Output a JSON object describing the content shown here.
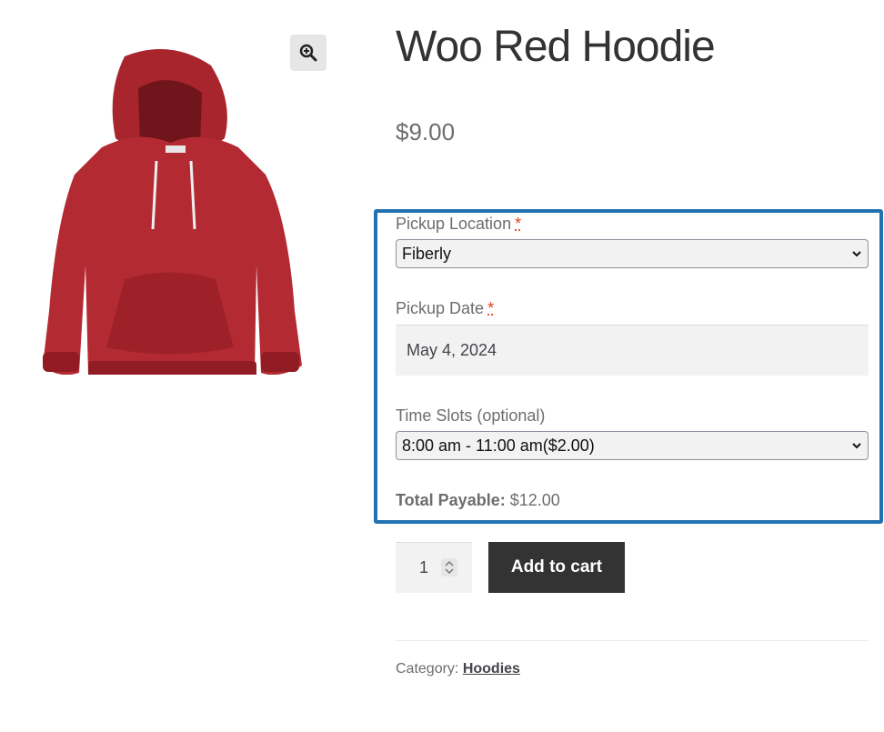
{
  "product": {
    "title": "Woo Red Hoodie",
    "price": "$9.00"
  },
  "gallery": {
    "zoom_icon": "magnifier-plus-icon",
    "image_alt": "Red hoodie"
  },
  "options": {
    "pickup_location": {
      "label": "Pickup Location",
      "required_mark": "*",
      "value": "Fiberly"
    },
    "pickup_date": {
      "label": "Pickup Date",
      "required_mark": "*",
      "value": "May 4, 2024"
    },
    "time_slots": {
      "label": "Time Slots (optional)",
      "value": "8:00 am - 11:00 am($2.00)"
    },
    "total": {
      "label": "Total Payable:",
      "value": "$12.00"
    },
    "highlight_color": "#2271b1"
  },
  "cart": {
    "quantity": "1",
    "add_label": "Add to cart"
  },
  "meta": {
    "category_label": "Category:",
    "category_value": "Hoodies"
  }
}
